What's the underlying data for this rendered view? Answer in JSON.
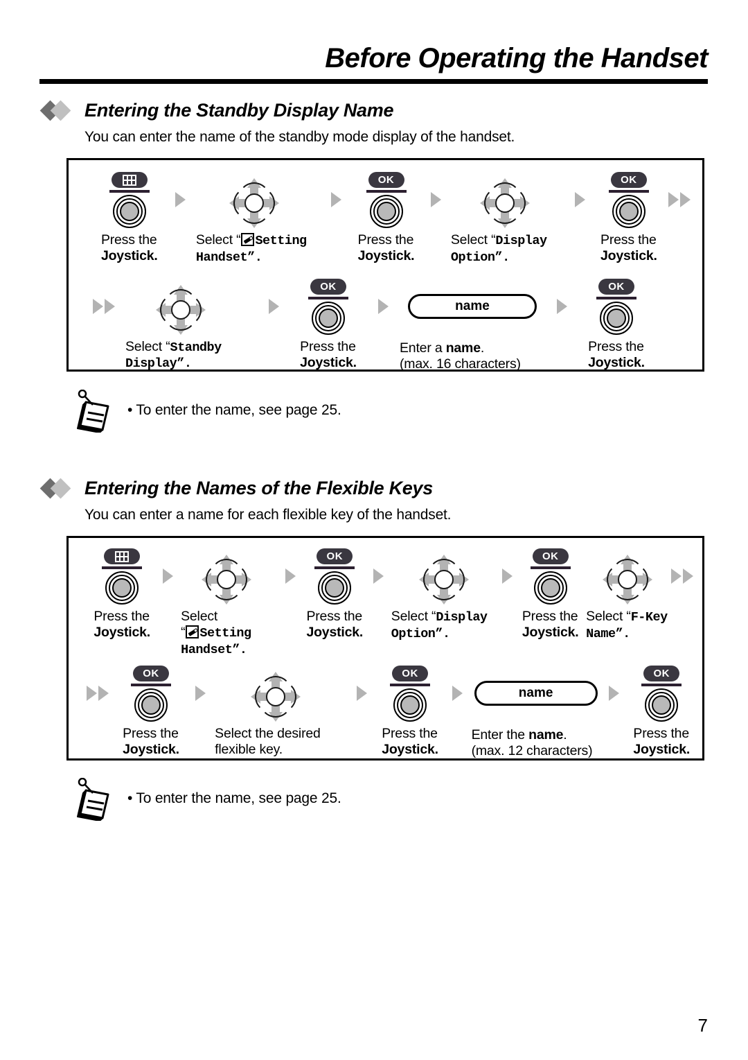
{
  "header": {
    "title": "Before Operating the Handset"
  },
  "sections": [
    {
      "heading": "Entering the Standby Display Name",
      "intro": "You can enter the name of the standby mode display of the handset.",
      "note": "• To enter the name, see page 25.",
      "note_icon": "memo-pad-icon",
      "rows": [
        {
          "steps": [
            {
              "icon": "menu-key-joystick",
              "key_label": "",
              "key_type": "menu",
              "caption_lines": [
                "Press the",
                "Joystick."
              ],
              "bold": [
                false,
                true
              ]
            },
            {
              "icon": "arrow-right",
              "type": "connector"
            },
            {
              "icon": "joystick-direction",
              "caption_lines": [
                "Select “⟦SET⟧Setting",
                "Handset”."
              ],
              "mono": true
            },
            {
              "icon": "arrow-right",
              "type": "connector"
            },
            {
              "icon": "ok-key-joystick",
              "key_label": "OK",
              "key_type": "ok",
              "caption_lines": [
                "Press the",
                "Joystick."
              ],
              "bold": [
                false,
                true
              ]
            },
            {
              "icon": "arrow-right",
              "type": "connector"
            },
            {
              "icon": "joystick-direction",
              "caption_lines": [
                "Select “Display",
                "Option”."
              ],
              "mono": true
            },
            {
              "icon": "arrow-right",
              "type": "connector"
            },
            {
              "icon": "ok-key-joystick",
              "key_label": "OK",
              "key_type": "ok",
              "caption_lines": [
                "Press the",
                "Joystick."
              ],
              "bold": [
                false,
                true
              ]
            },
            {
              "icon": "arrow-right-double",
              "type": "connector"
            }
          ]
        },
        {
          "steps": [
            {
              "icon": "arrow-right-double",
              "type": "connector"
            },
            {
              "icon": "joystick-direction",
              "caption_lines": [
                "Select “Standby",
                "Display”."
              ],
              "mono": true
            },
            {
              "icon": "arrow-right",
              "type": "connector"
            },
            {
              "icon": "ok-key-joystick",
              "key_label": "OK",
              "key_type": "ok",
              "caption_lines": [
                "Press the",
                "Joystick."
              ],
              "bold": [
                false,
                true
              ]
            },
            {
              "icon": "arrow-right",
              "type": "connector"
            },
            {
              "icon": "name-field",
              "field_value": "name",
              "caption_lines": [
                "Enter a name.",
                "(max. 16 characters)"
              ]
            },
            {
              "icon": "arrow-right",
              "type": "connector"
            },
            {
              "icon": "ok-key-joystick",
              "key_label": "OK",
              "key_type": "ok",
              "caption_lines": [
                "Press the",
                "Joystick."
              ],
              "bold": [
                false,
                true
              ]
            }
          ]
        }
      ]
    },
    {
      "heading": "Entering the Names of the Flexible Keys",
      "intro": "You can enter a name for each flexible key of the handset.",
      "note": "• To enter the name, see page 25.",
      "note_icon": "memo-pad-icon",
      "rows": []
    }
  ],
  "labels": {
    "press_the": "Press the",
    "joystick": "Joystick",
    "joystick_period": "Joystick.",
    "select": "Select",
    "setting_handset_1": "Setting",
    "setting_handset_2": "Handset”.",
    "display": "Display",
    "option": "Option”.",
    "standby": "Standby",
    "display_close": "Display”.",
    "fkey": "F-Key",
    "name_close": "Name”.",
    "select_quote": "Select “",
    "enter_a_name_1": "Enter a ",
    "enter_the_name_1": "Enter the ",
    "name_word": "name",
    "period": ".",
    "max16": "(max. 16 characters)",
    "max12": "(max. 12 characters)",
    "select_desired_1": "Select the desired",
    "select_desired_2": "flexible key.",
    "name_field_value": "name",
    "ok": "OK"
  },
  "page_number": "7",
  "colors": {
    "key_pill": "#3a3740",
    "arrow_gray": "#b3b3b3",
    "diamond_dark": "#6e6e6e",
    "diamond_light": "#c0c0c0",
    "joystick_center": "#b9b9b9",
    "rule": "#000000"
  }
}
